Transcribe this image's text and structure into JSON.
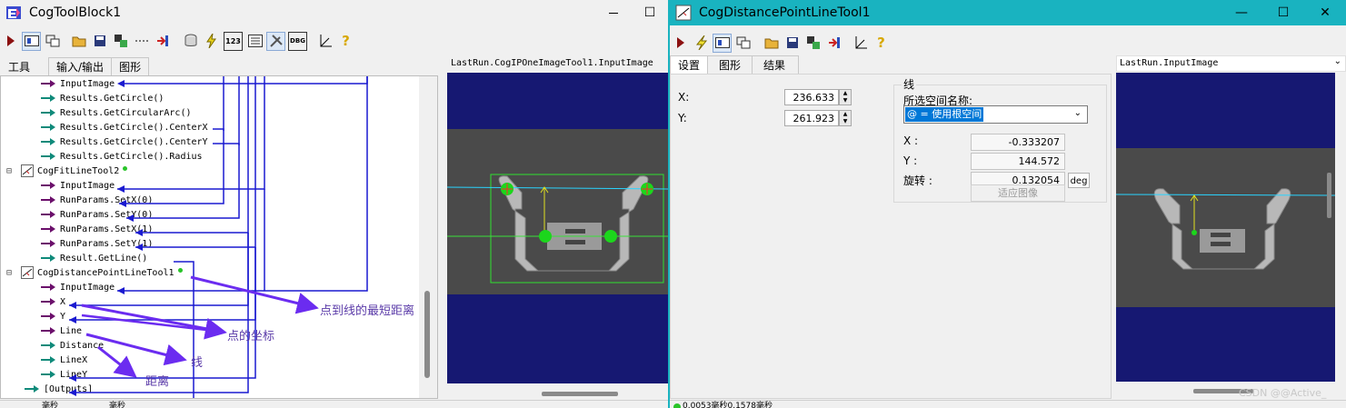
{
  "left_window": {
    "title": "CogToolBlock1",
    "maximize_glyph": "☐",
    "tabs": [
      "工具",
      "输入/输出",
      "图形"
    ],
    "image_caption": "LastRun.CogIPOneImageTool1.InputImage",
    "tree": [
      {
        "label": "InputImage",
        "kind": "input"
      },
      {
        "label": "Results.GetCircle()",
        "kind": "output"
      },
      {
        "label": "Results.GetCircularArc()",
        "kind": "output"
      },
      {
        "label": "Results.GetCircle().CenterX",
        "kind": "output"
      },
      {
        "label": "Results.GetCircle().CenterY",
        "kind": "output"
      },
      {
        "label": "Results.GetCircle().Radius",
        "kind": "output"
      },
      {
        "label": "CogFitLineTool2",
        "kind": "tool"
      },
      {
        "label": "InputImage",
        "kind": "input"
      },
      {
        "label": "RunParams.SetX(0)",
        "kind": "input"
      },
      {
        "label": "RunParams.SetY(0)",
        "kind": "input"
      },
      {
        "label": "RunParams.SetX(1)",
        "kind": "input"
      },
      {
        "label": "RunParams.SetY(1)",
        "kind": "input"
      },
      {
        "label": "Result.GetLine()",
        "kind": "output"
      },
      {
        "label": "CogDistancePointLineTool1",
        "kind": "tool"
      },
      {
        "label": "InputImage",
        "kind": "input"
      },
      {
        "label": "X",
        "kind": "input"
      },
      {
        "label": "Y",
        "kind": "input"
      },
      {
        "label": "Line",
        "kind": "input"
      },
      {
        "label": "Distance",
        "kind": "output"
      },
      {
        "label": "LineX",
        "kind": "output"
      },
      {
        "label": "LineY",
        "kind": "output"
      },
      {
        "label": "[Outputs]",
        "kind": "outputs"
      }
    ],
    "annotations": {
      "shortest_distance": "点到线的最短距离",
      "point_coords": "点的坐标",
      "line": "线",
      "distance": "距离"
    },
    "status_fragments": [
      "毫秒",
      "毫秒"
    ]
  },
  "right_window": {
    "title": "CogDistancePointLineTool1",
    "minimize_glyph": "—",
    "maximize_glyph": "☐",
    "close_glyph": "✕",
    "tabs": [
      "设置",
      "图形",
      "结果"
    ],
    "x_label": "X:",
    "x_value": "236.633",
    "y_label": "Y:",
    "y_value": "261.923",
    "line_group_title": "线",
    "space_name_label": "所选空间名称:",
    "space_name_value": "@ = 使用根空间",
    "line_x_label": "X :",
    "line_x_value": "-0.333207",
    "line_y_label": "Y :",
    "line_y_value": "144.572",
    "rotation_label": "旋转 :",
    "rotation_value": "0.132054",
    "rotation_unit": "deg",
    "fit_image_button": "适应图像",
    "image_caption": "LastRun.InputImage",
    "status_text": "0.0053毫秒0.1578毫秒",
    "watermark": "CSDN @@Active_"
  },
  "colors": {
    "image_background": "#161872",
    "input_arrow": "#6b0f6b",
    "output_arrow": "#0f8a7a",
    "link_line": "#1a1ad0",
    "annotation_arrow": "#6b2cf0",
    "annotation_text": "#5a3aa8",
    "right_title_bar": "#19b3c0"
  }
}
